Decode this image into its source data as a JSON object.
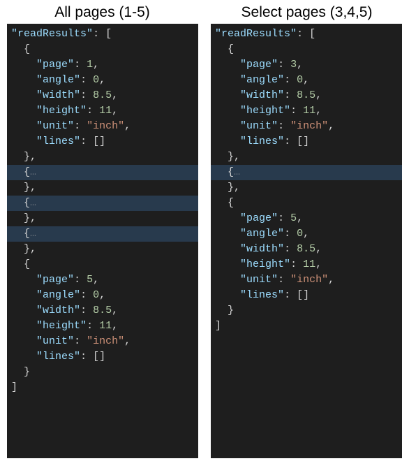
{
  "title_left": "All pages (1-5)",
  "title_right": "Select pages (3,4,5)",
  "root_key": "readResults",
  "field_page": "page",
  "field_angle": "angle",
  "field_width": "width",
  "field_height": "height",
  "field_unit": "unit",
  "field_lines": "lines",
  "left": {
    "first_page": "1",
    "angle": "0",
    "width": "8.5",
    "height": "11",
    "unit": "inch",
    "last_page": "5",
    "last_angle": "0",
    "last_width": "8.5",
    "last_height": "11",
    "last_unit": "inch"
  },
  "right": {
    "first_page": "3",
    "angle": "0",
    "width": "8.5",
    "height": "11",
    "unit": "inch",
    "last_page": "5",
    "last_angle": "0",
    "last_width": "8.5",
    "last_height": "11",
    "last_unit": "inch"
  },
  "dots": "…",
  "colors": {
    "background": "#1e1e1e",
    "key": "#9cdcfe",
    "string": "#ce9178",
    "number": "#b5cea8",
    "fold_bg": "#283a4d"
  }
}
